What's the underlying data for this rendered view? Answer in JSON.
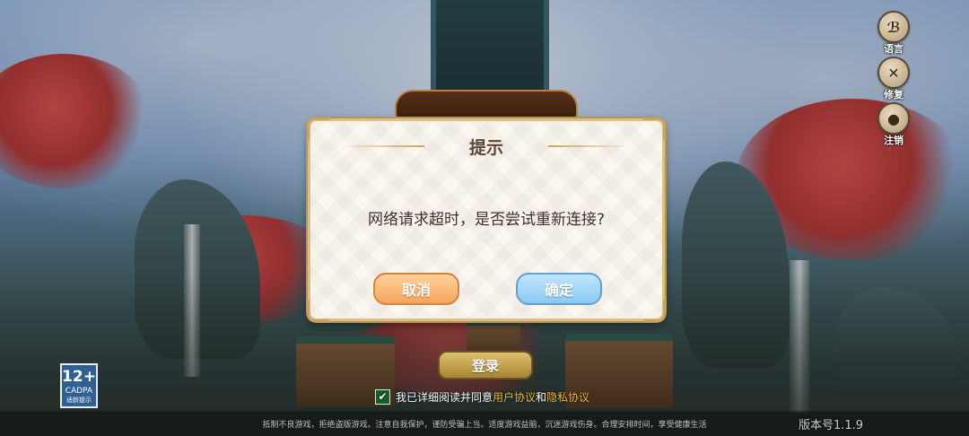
{
  "side_menu": {
    "language": {
      "label": "语言",
      "icon": "language-icon"
    },
    "repair": {
      "label": "修复",
      "icon": "wrench-icon"
    },
    "logout": {
      "label": "注销",
      "icon": "user-icon"
    }
  },
  "dialog": {
    "title": "提示",
    "message": "网络请求超时，是否尝试重新连接?",
    "cancel_label": "取消",
    "confirm_label": "确定"
  },
  "age_rating": {
    "age": "12+",
    "org": "CADPA",
    "tip": "适龄提示"
  },
  "login_label": "登录",
  "agreement": {
    "checked": true,
    "prefix": "我已详细阅读并同意",
    "user_agreement": "用户协议",
    "and": "和",
    "privacy_policy": "隐私协议"
  },
  "footer": {
    "notice": "抵制不良游戏，拒绝盗版游戏。注意自我保护，谨防受骗上当。适度游戏益脑，沉迷游戏伤身。合理安排时间，享受健康生活",
    "version": "版本号1.1.9"
  },
  "colors": {
    "accent_gold": "#c9a35d",
    "cancel_orange": "#f6a45f",
    "confirm_blue": "#8cc8f2",
    "link_orange": "#f2b534"
  }
}
